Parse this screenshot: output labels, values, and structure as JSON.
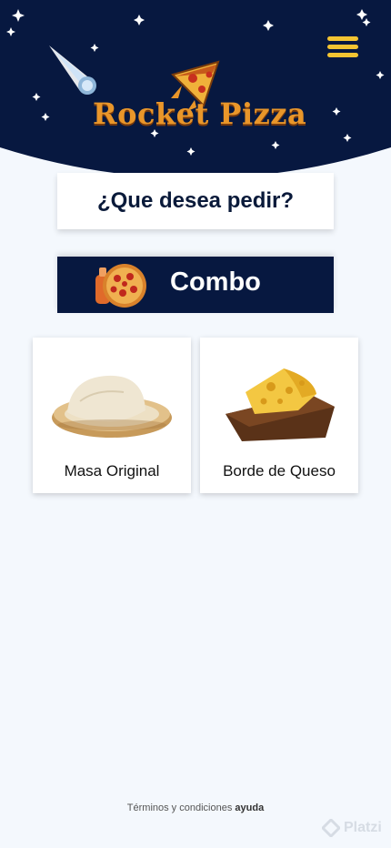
{
  "header": {
    "brand": "Rocket Pizza",
    "menu_icon": "hamburger-menu-icon",
    "background_color": "#071840",
    "accent_color": "#f3c432"
  },
  "question": {
    "text": "¿Que desea pedir?"
  },
  "combo": {
    "label": "Combo",
    "icon": "pizza-soda-icon"
  },
  "options": [
    {
      "label": "Masa Original",
      "image": "dough-image"
    },
    {
      "label": "Borde de Queso",
      "image": "cheese-board-image"
    }
  ],
  "footer": {
    "terms_label": "Términos y condiciones",
    "help_label": "ayuda"
  },
  "watermark": {
    "text": "Platzi"
  }
}
